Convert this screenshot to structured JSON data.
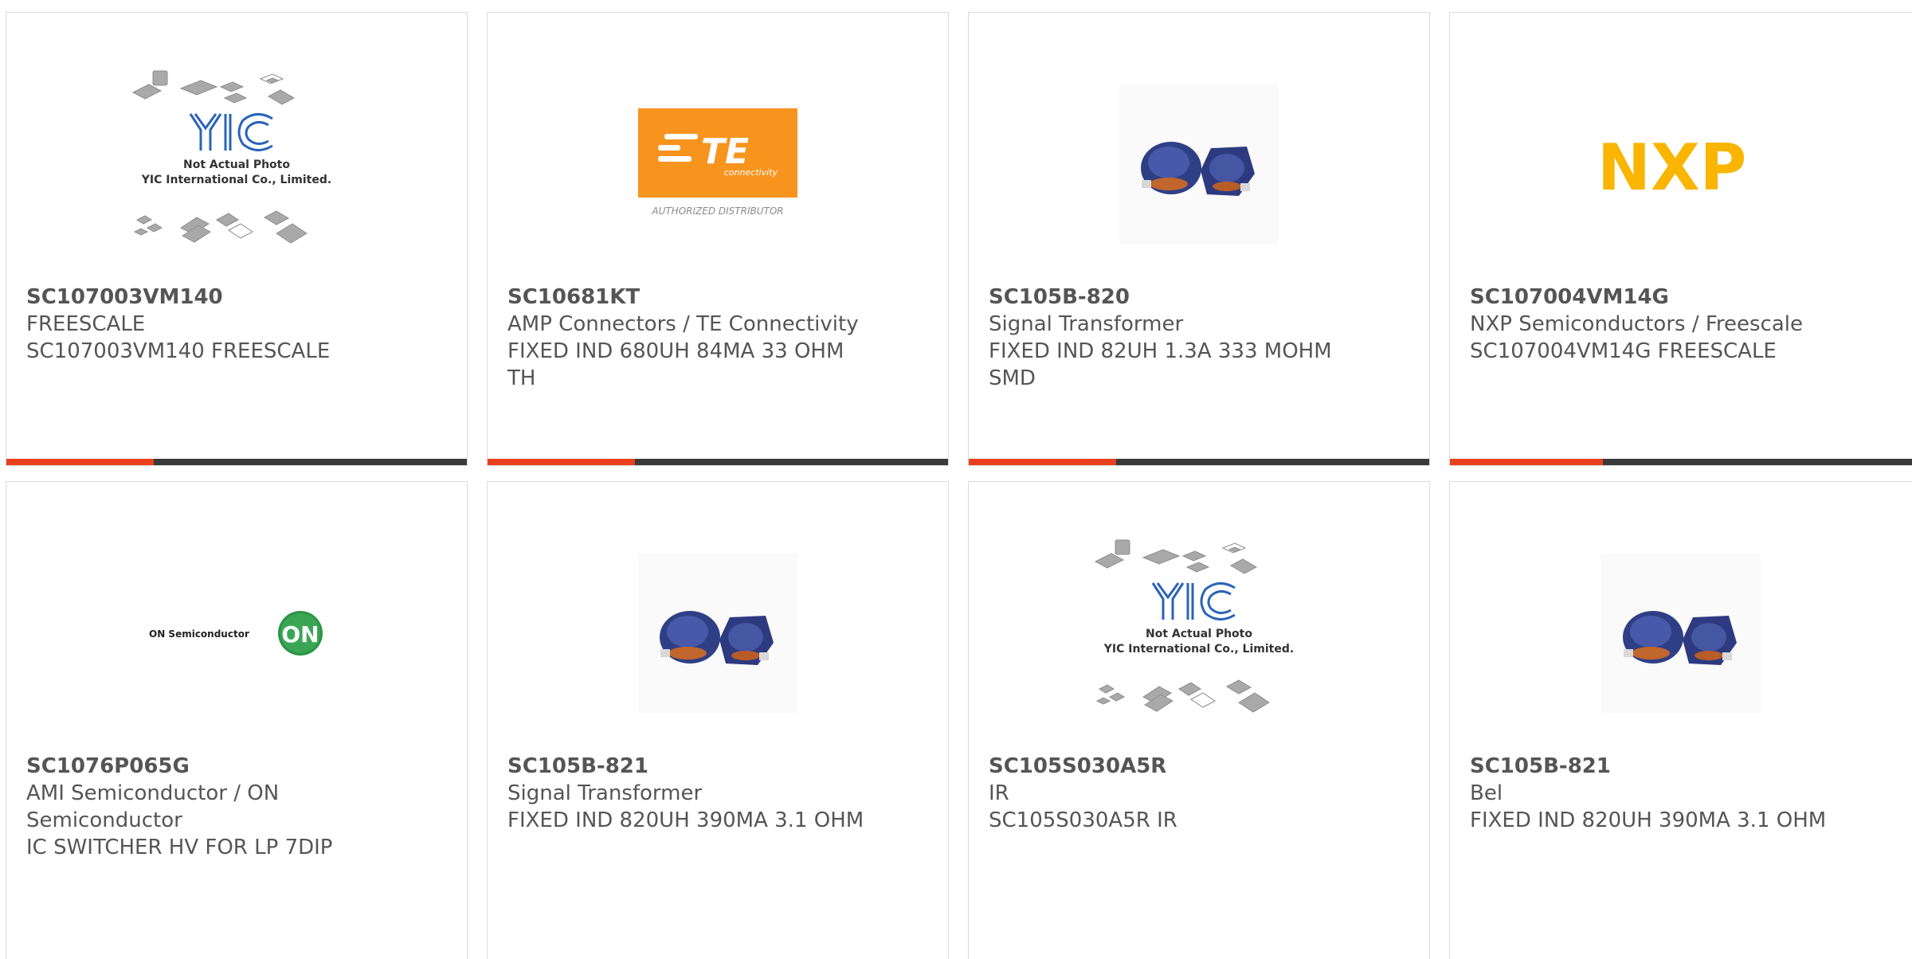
{
  "theme": {
    "accent": "#e8401c",
    "track": "#3a3a3a",
    "text": "#555555"
  },
  "cards": [
    {
      "part_number": "SC107003VM140",
      "manufacturer": "FREESCALE",
      "description": "SC107003VM140 FREESCALE",
      "image": "yic-placeholder",
      "placeholder_line1": "Not Actual Photo",
      "placeholder_line2": "YIC International Co., Limited.",
      "progress": 0.32
    },
    {
      "part_number": "SC10681KT",
      "manufacturer": "AMP Connectors / TE Connectivity",
      "description": "FIXED IND 680UH 84MA 33 OHM TH",
      "image": "te-logo",
      "logo_text": "TE",
      "logo_sub": "connectivity",
      "logo_caption": "AUTHORIZED DISTRIBUTOR",
      "progress": 0.32
    },
    {
      "part_number": "SC105B-820",
      "manufacturer": "Signal Transformer",
      "description": "FIXED IND 82UH 1.3A 333 MOHM SMD",
      "image": "inductor-photo",
      "progress": 0.32
    },
    {
      "part_number": "SC107004VM14G",
      "manufacturer": "NXP Semiconductors / Freescale",
      "description": "SC107004VM14G FREESCALE",
      "image": "nxp-logo",
      "logo_text": "NXP",
      "progress": 0.32
    },
    {
      "part_number": "SC1076P065G",
      "manufacturer": "AMI Semiconductor / ON Semiconductor",
      "description": "IC SWITCHER HV FOR LP 7DIP",
      "image": "on-logo",
      "logo_text": "ON Semiconductor",
      "badge_text": "ON"
    },
    {
      "part_number": "SC105B-821",
      "manufacturer": "Signal Transformer",
      "description": "FIXED IND 820UH 390MA 3.1 OHM",
      "image": "inductor-photo"
    },
    {
      "part_number": "SC105S030A5R",
      "manufacturer": "IR",
      "description": "SC105S030A5R IR",
      "image": "yic-placeholder",
      "placeholder_line1": "Not Actual Photo",
      "placeholder_line2": "YIC International Co., Limited."
    },
    {
      "part_number": "SC105B-821",
      "manufacturer": "Bel",
      "description": "FIXED IND 820UH 390MA 3.1 OHM",
      "image": "inductor-photo"
    }
  ]
}
